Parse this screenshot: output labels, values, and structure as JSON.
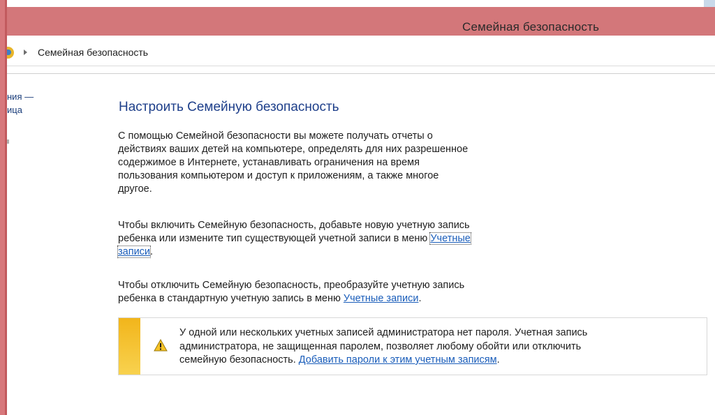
{
  "window": {
    "title": "Семейная безопасность"
  },
  "address_bar": {
    "breadcrumb": "Семейная безопасность"
  },
  "sidebar": {
    "link_part_1": "ния —",
    "link_part_2": "ица"
  },
  "main": {
    "heading": "Настроить Семейную безопасность",
    "intro_lines": [
      "С помощью Семейной безопасности вы можете получать отчеты о",
      "действиях ваших детей на компьютере, определять для них разрешенное",
      "содержимое в Интернете, устанавливать ограничения на время",
      "пользования компьютером и доступ к приложениям, а также многое",
      "другое."
    ],
    "enable_line_1": "Чтобы включить Семейную безопасность, добавьте новую учетную запись",
    "enable_line_2": "ребенка или измените тип существующей учетной записи в меню ",
    "enable_link_part_1": "Учетные",
    "enable_link_part_2": "записи",
    "enable_end": ".",
    "disable_line_1": "Чтобы отключить Семейную безопасность, преобразуйте учетную запись",
    "disable_line_2": "ребенка в стандартную учетную запись в меню ",
    "disable_link": "Учетные записи",
    "disable_end": "."
  },
  "notice": {
    "icon": "warning-icon",
    "line_1": "У одной или нескольких учетных записей администратора нет пароля. Учетная запись",
    "line_2": "администратора, не защищенная паролем, позволяет любому обойти или отключить",
    "line_3": "семейную безопасность. ",
    "link": "Добавить пароли к этим учетным записям",
    "end": "."
  },
  "colors": {
    "title_bar": "#d3777a",
    "heading": "#1e3f8a",
    "link": "#1a5dba",
    "notice_accent": "#f2b51b"
  }
}
